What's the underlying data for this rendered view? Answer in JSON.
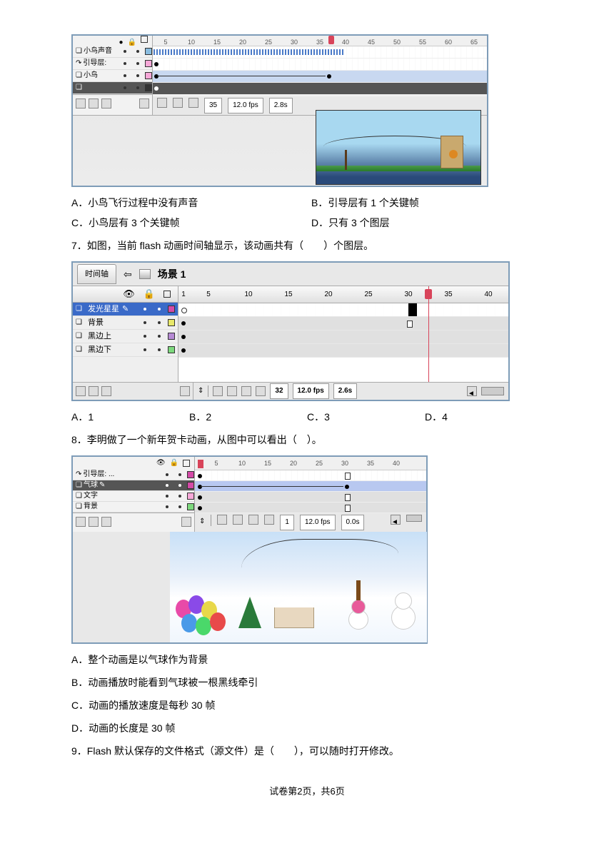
{
  "panel1": {
    "ruler": [
      "5",
      "10",
      "15",
      "20",
      "25",
      "30",
      "35",
      "40",
      "45",
      "50",
      "55",
      "60",
      "65"
    ],
    "layers": [
      "小鸟声音",
      "引导层:",
      "小鸟",
      ""
    ],
    "status": {
      "frame": "35",
      "fps": "12.0 fps",
      "time": "2.8s"
    }
  },
  "q6_options": {
    "A": "A．小鸟飞行过程中没有声音",
    "B": "B．引导层有 1 个关键帧",
    "C": "C．小鸟层有 3 个关键帧",
    "D": "D．只有 3 个图层"
  },
  "q7_text": "7．如图，当前 flash 动画时间轴显示，该动画共有（　　）个图层。",
  "panel2": {
    "tab_timeline": "时间轴",
    "scene": "场景 1",
    "ruler": [
      "1",
      "5",
      "10",
      "15",
      "20",
      "25",
      "30",
      "35",
      "40"
    ],
    "layers": [
      "发光星星",
      "背景",
      "黑边上",
      "黑边下"
    ],
    "status": {
      "frame": "32",
      "fps": "12.0 fps",
      "time": "2.6s"
    }
  },
  "q7_options": {
    "A": "A．1",
    "B": "B．2",
    "C": "C．3",
    "D": "D．4"
  },
  "q8_text": "8．李明做了一个新年贺卡动画，从图中可以看出（　）。",
  "panel3": {
    "ruler": [
      "1",
      "5",
      "10",
      "15",
      "20",
      "25",
      "30",
      "35",
      "40"
    ],
    "layers": [
      "引导层: ...",
      "气球",
      "文字",
      "背景"
    ],
    "status": {
      "frame": "1",
      "fps": "12.0 fps",
      "time": "0.0s"
    }
  },
  "q8_options": {
    "A": "A．整个动画是以气球作为背景",
    "B": "B．动画播放时能看到气球被一根黑线牵引",
    "C": "C．动画的播放速度是每秒 30 帧",
    "D": "D．动画的长度是 30 帧"
  },
  "q9_text": "9．Flash 默认保存的文件格式（源文件）是（　　），可以随时打开修改。",
  "page_footer": "试卷第2页，共6页"
}
